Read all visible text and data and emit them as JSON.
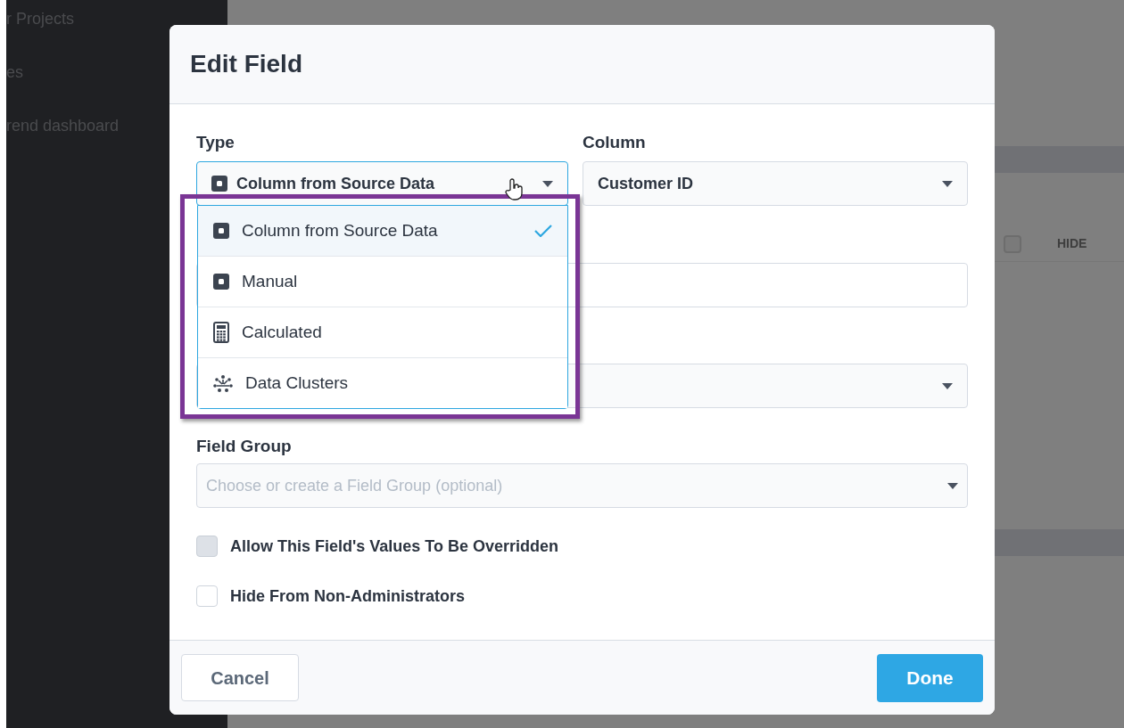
{
  "background": {
    "sidebar_items": [
      "r Projects",
      "es",
      "rend dashboard"
    ],
    "header_checkbox": {
      "checked": false
    },
    "table_header_right": "HIDE"
  },
  "dialog": {
    "title": "Edit Field",
    "type_label": "Type",
    "type_value": "Column from Source Data",
    "column_label": "Column",
    "column_value": "Customer ID",
    "type_menu": [
      {
        "label": "Column from Source Data",
        "kind": "square",
        "selected": true
      },
      {
        "label": "Manual",
        "kind": "square",
        "selected": false
      },
      {
        "label": "Calculated",
        "kind": "calculator",
        "selected": false
      },
      {
        "label": "Data Clusters",
        "kind": "clusters",
        "selected": false
      }
    ],
    "field_group_label": "Field Group",
    "field_group_placeholder": "Choose or create a Field Group (optional)",
    "checkboxes": [
      {
        "label": "Allow This Field's Values To Be Overridden",
        "checked": false,
        "disabled": true
      },
      {
        "label": "Hide From Non-Administrators",
        "checked": false,
        "disabled": false
      }
    ],
    "buttons": {
      "cancel": "Cancel",
      "done": "Done"
    }
  }
}
